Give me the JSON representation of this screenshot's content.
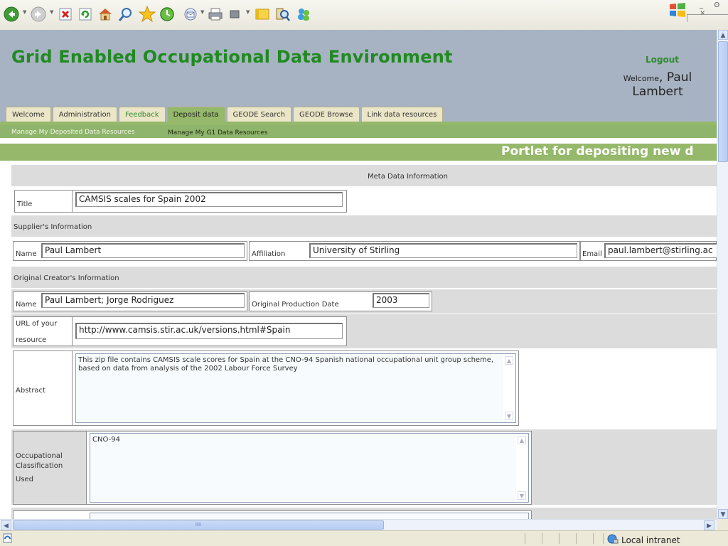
{
  "browser": {
    "toolbar_icons": [
      "back-icon",
      "forward-icon",
      "stop-icon",
      "refresh-icon",
      "home-icon",
      "search-icon",
      "favorites-icon",
      "history-icon",
      "mail-icon",
      "print-icon",
      "edit-icon",
      "discuss-icon",
      "research-icon",
      "messenger-icon"
    ],
    "window_controls": "_  ʘ  ×",
    "status_zone": "Local intranet",
    "hscroll_grip": "IIII"
  },
  "header": {
    "site_title": "Grid Enabled Occupational Data Environment",
    "logout": "Logout",
    "welcome_prefix": "Welcome",
    "welcome_sep": ", ",
    "user_first": "Paul",
    "user_last": "Lambert"
  },
  "tabs": [
    {
      "label": "Welcome"
    },
    {
      "label": "Administration"
    },
    {
      "label": "Feedback"
    },
    {
      "label": "Deposit data"
    },
    {
      "label": "GEODE Search"
    },
    {
      "label": "GEODE Browse"
    },
    {
      "label": "Link data resources"
    }
  ],
  "subnav": {
    "item1": "Manage My Deposited Data Resources",
    "item2": "Manage My G1 Data Resources"
  },
  "portlet": {
    "title": "Portlet for depositing new d"
  },
  "form": {
    "meta_header": "Meta Data Information",
    "title_label": "Title",
    "title_value": "CAMSIS scales for Spain 2002",
    "supplier_header": "Supplier's Information",
    "supplier_name_label": "Name",
    "supplier_name_value": "Paul Lambert",
    "affiliation_label": "Affiliation",
    "affiliation_value": "University of Stirling",
    "email_label": "Email",
    "email_value": "paul.lambert@stirling.ac",
    "creator_header": "Original Creator's Information",
    "creator_name_label": "Name",
    "creator_name_value": "Paul Lambert; Jorge Rodriguez",
    "production_date_label": "Original Production Date",
    "production_date_value": "2003",
    "url_label_line1": "URL of your",
    "url_label_line2": "resource",
    "url_value": "http://www.camsis.stir.ac.uk/versions.html#Spain",
    "abstract_label": "Abstract",
    "abstract_value": "This zip file contains CAMSIS scale scores for Spain at the CNO-94 Spanish national occupational unit group scheme, based on data from analysis of the 2002 Labour Force Survey",
    "occ_label_line1": "Occupational",
    "occ_label_line2": "Classification",
    "occ_label_line3": "Used",
    "occ_value": "CNO-94"
  },
  "colors": {
    "banner": "#a7b3c2",
    "title_green": "#1f8a1f",
    "nav_green": "#95b86a",
    "row_gray": "#dcdcdc"
  }
}
